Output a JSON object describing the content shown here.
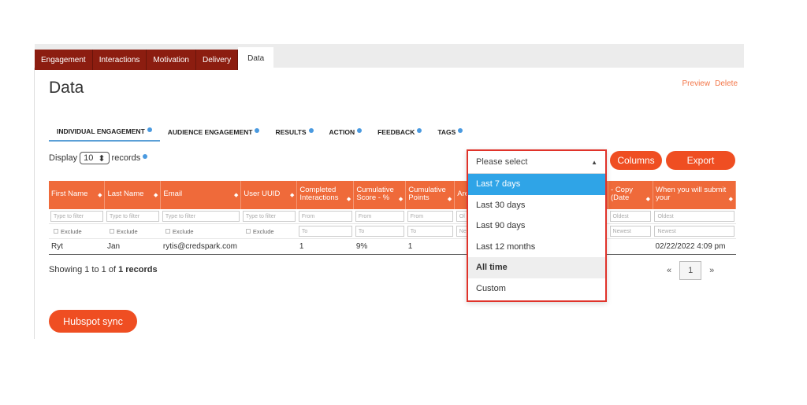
{
  "top_tabs": [
    "Engagement",
    "Interactions",
    "Motivation",
    "Delivery",
    "Data"
  ],
  "page_title": "Data",
  "preview_label": "Preview",
  "delete_label": "Delete",
  "sub_tabs": [
    "INDIVIDUAL ENGAGEMENT",
    "AUDIENCE ENGAGEMENT",
    "RESULTS",
    "ACTION",
    "FEEDBACK",
    "TAGS"
  ],
  "display": {
    "prefix": "Display",
    "value": "10",
    "suffix": "records"
  },
  "columns_label": "Columns",
  "export_label": "Export",
  "table": {
    "headers": [
      "First Name",
      "Last Name",
      "Email",
      "User UUID",
      "Completed Interactions",
      "Cumulative Score - %",
      "Cumulative Points",
      "Are ou",
      "- Copy (Date",
      "When you will submit your"
    ],
    "filters": [
      "Type to filter",
      "Type to filter",
      "Type to filter",
      "Type to filter",
      "From",
      "From",
      "From",
      "Ol",
      "Oldest",
      "Oldest"
    ],
    "filters2": [
      "Exclude",
      "Exclude",
      "Exclude",
      "Exclude",
      "To",
      "To",
      "To",
      "Ne",
      "Newest",
      "Newest"
    ],
    "row": [
      "Ryt",
      "Jan",
      "rytis@credspark.com",
      "",
      "1",
      "9%",
      "1",
      "",
      "",
      "02/22/2022 4:09 pm"
    ]
  },
  "showing": {
    "prefix": "Showing 1 to 1 of",
    "bold": "1 records"
  },
  "pager": {
    "prev": "«",
    "page": "1",
    "next": "»"
  },
  "dropdown": {
    "placeholder": "Please select",
    "options": [
      "Last 7 days",
      "Last 30 days",
      "Last 90 days",
      "Last 12 months",
      "All time",
      "Custom"
    ]
  },
  "hubspot_label": "Hubspot sync",
  "colors": {
    "accent": "#ef4e22",
    "tab_dark": "#8c1d10",
    "highlight": "#2fa4e7"
  }
}
